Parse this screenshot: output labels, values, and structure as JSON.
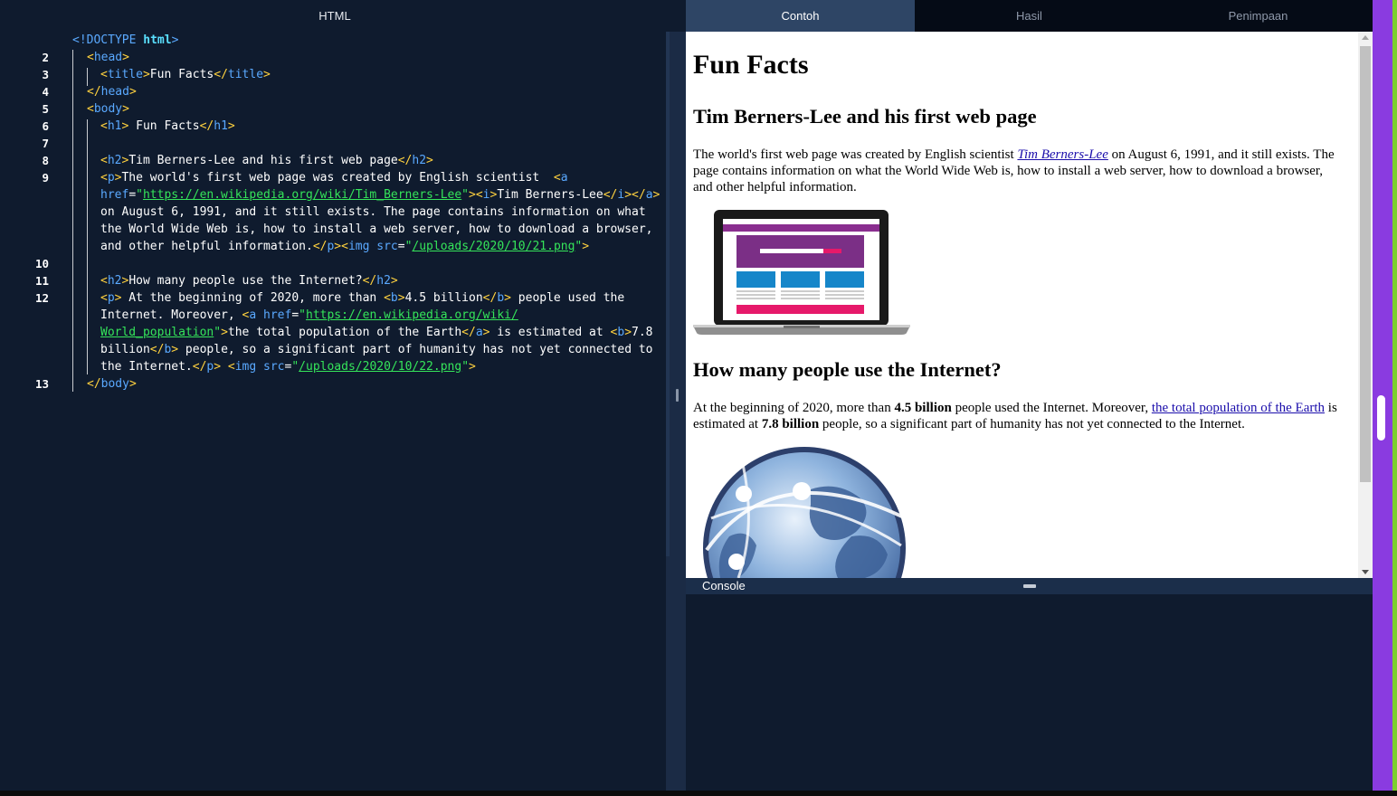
{
  "editor": {
    "title": "HTML",
    "line_numbers": [
      "2",
      "3",
      "4",
      "5",
      "6",
      "7",
      "8",
      "9",
      "10",
      "11",
      "12",
      "13"
    ]
  },
  "tabs": [
    {
      "label": "Contoh",
      "active": true
    },
    {
      "label": "Hasil",
      "active": false
    },
    {
      "label": "Penimpaan",
      "active": false
    }
  ],
  "preview": {
    "h1": "Fun Facts",
    "h2_1": "Tim Berners-Lee and his first web page",
    "p1_before": "The world's first web page was created by English scientist ",
    "p1_link": "Tim Berners-Lee",
    "p1_after": " on August 6, 1991, and it still exists. The page contains information on what the World Wide Web is, how to install a web server, how to download a browser, and other helpful information.",
    "h2_2": "How many people use the Internet?",
    "p2_a": "At the beginning of 2020, more than ",
    "p2_b1": "4.5 billion",
    "p2_c": " people used the Internet. Moreover, ",
    "p2_link": "the total population of the Earth",
    "p2_d": " is estimated at ",
    "p2_b2": "7.8 billion",
    "p2_e": " people, so a significant part of humanity has not yet connected to the Internet."
  },
  "console": {
    "label": "Console"
  },
  "colors": {
    "accent_purple": "#8a3be0",
    "accent_green": "#7ccf2e",
    "editor_bg": "#0f1b2e",
    "active_tab": "#2e4565"
  }
}
